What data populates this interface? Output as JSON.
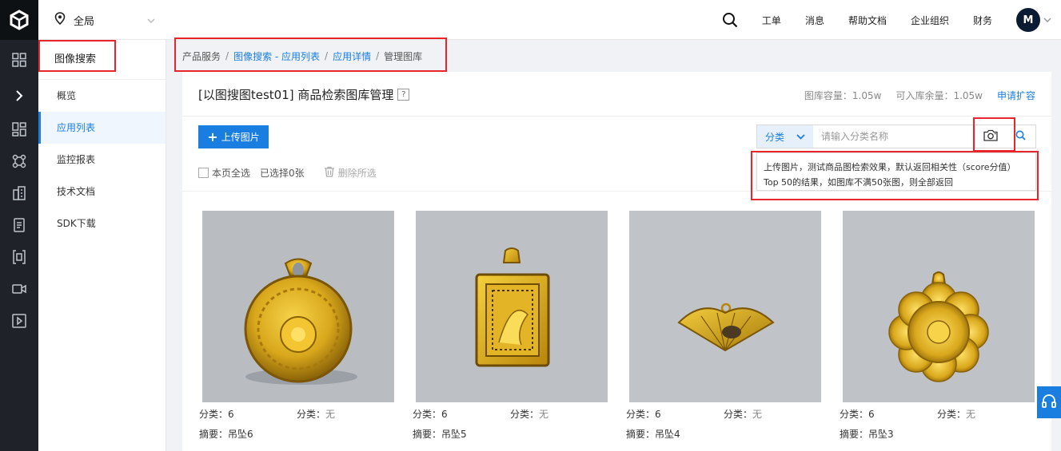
{
  "header": {
    "region_label": "全局",
    "nav": [
      "工单",
      "消息",
      "帮助文档",
      "企业组织",
      "财务"
    ],
    "avatar_initial": "M"
  },
  "rail": {
    "icons": [
      "logo-icon",
      "grid-icon",
      "expand-arrow-icon",
      "dashboard-icon",
      "network-icon",
      "building-icon",
      "document-icon",
      "brackets-icon",
      "video-icon",
      "play-icon"
    ]
  },
  "sidebar": {
    "title": "图像搜索",
    "items": [
      {
        "label": "概览",
        "active": false
      },
      {
        "label": "应用列表",
        "active": true
      },
      {
        "label": "监控报表",
        "active": false
      },
      {
        "label": "技术文档",
        "active": false
      },
      {
        "label": "SDK下载",
        "active": false
      }
    ]
  },
  "breadcrumb": {
    "items": [
      "产品服务",
      "图像搜索 - 应用列表",
      "应用详情",
      "管理图库"
    ],
    "separator": "/"
  },
  "page": {
    "title": "[以图搜图test01] 商品检索图库管理",
    "help_mark": "?",
    "capacity": "图库容量：1.05w",
    "remaining": "可入库余量：1.05w",
    "expand_link": "申请扩容"
  },
  "toolbar": {
    "upload_label": "上传图片",
    "select_all": "本页全选",
    "selected_count": "已选择0张",
    "delete_selected": "删除所选"
  },
  "filter": {
    "category_label": "分类",
    "placeholder": "请输入分类名称"
  },
  "tooltip": {
    "text": "上传图片，测试商品图检索效果，默认返回相关性（score分值）Top 50的结果，如图库不满50张图，则全部返回"
  },
  "products": [
    {
      "category_key": "分类：",
      "category_value": "6",
      "class_key": "分类：",
      "class_value": "无",
      "summary_key": "摘要：",
      "summary_value": "吊坠6"
    },
    {
      "category_key": "分类：",
      "category_value": "6",
      "class_key": "分类：",
      "class_value": "无",
      "summary_key": "摘要：",
      "summary_value": "吊坠5"
    },
    {
      "category_key": "分类：",
      "category_value": "6",
      "class_key": "分类：",
      "class_value": "无",
      "summary_key": "摘要：",
      "summary_value": "吊坠4"
    },
    {
      "category_key": "分类：",
      "category_value": "6",
      "class_key": "分类：",
      "class_value": "无",
      "summary_key": "摘要：",
      "summary_value": "吊坠3"
    }
  ],
  "colors": {
    "accent": "#1a7ee0",
    "rail": "#1f2329",
    "annotation": "#e8252b",
    "gold": "#d9a81c"
  }
}
